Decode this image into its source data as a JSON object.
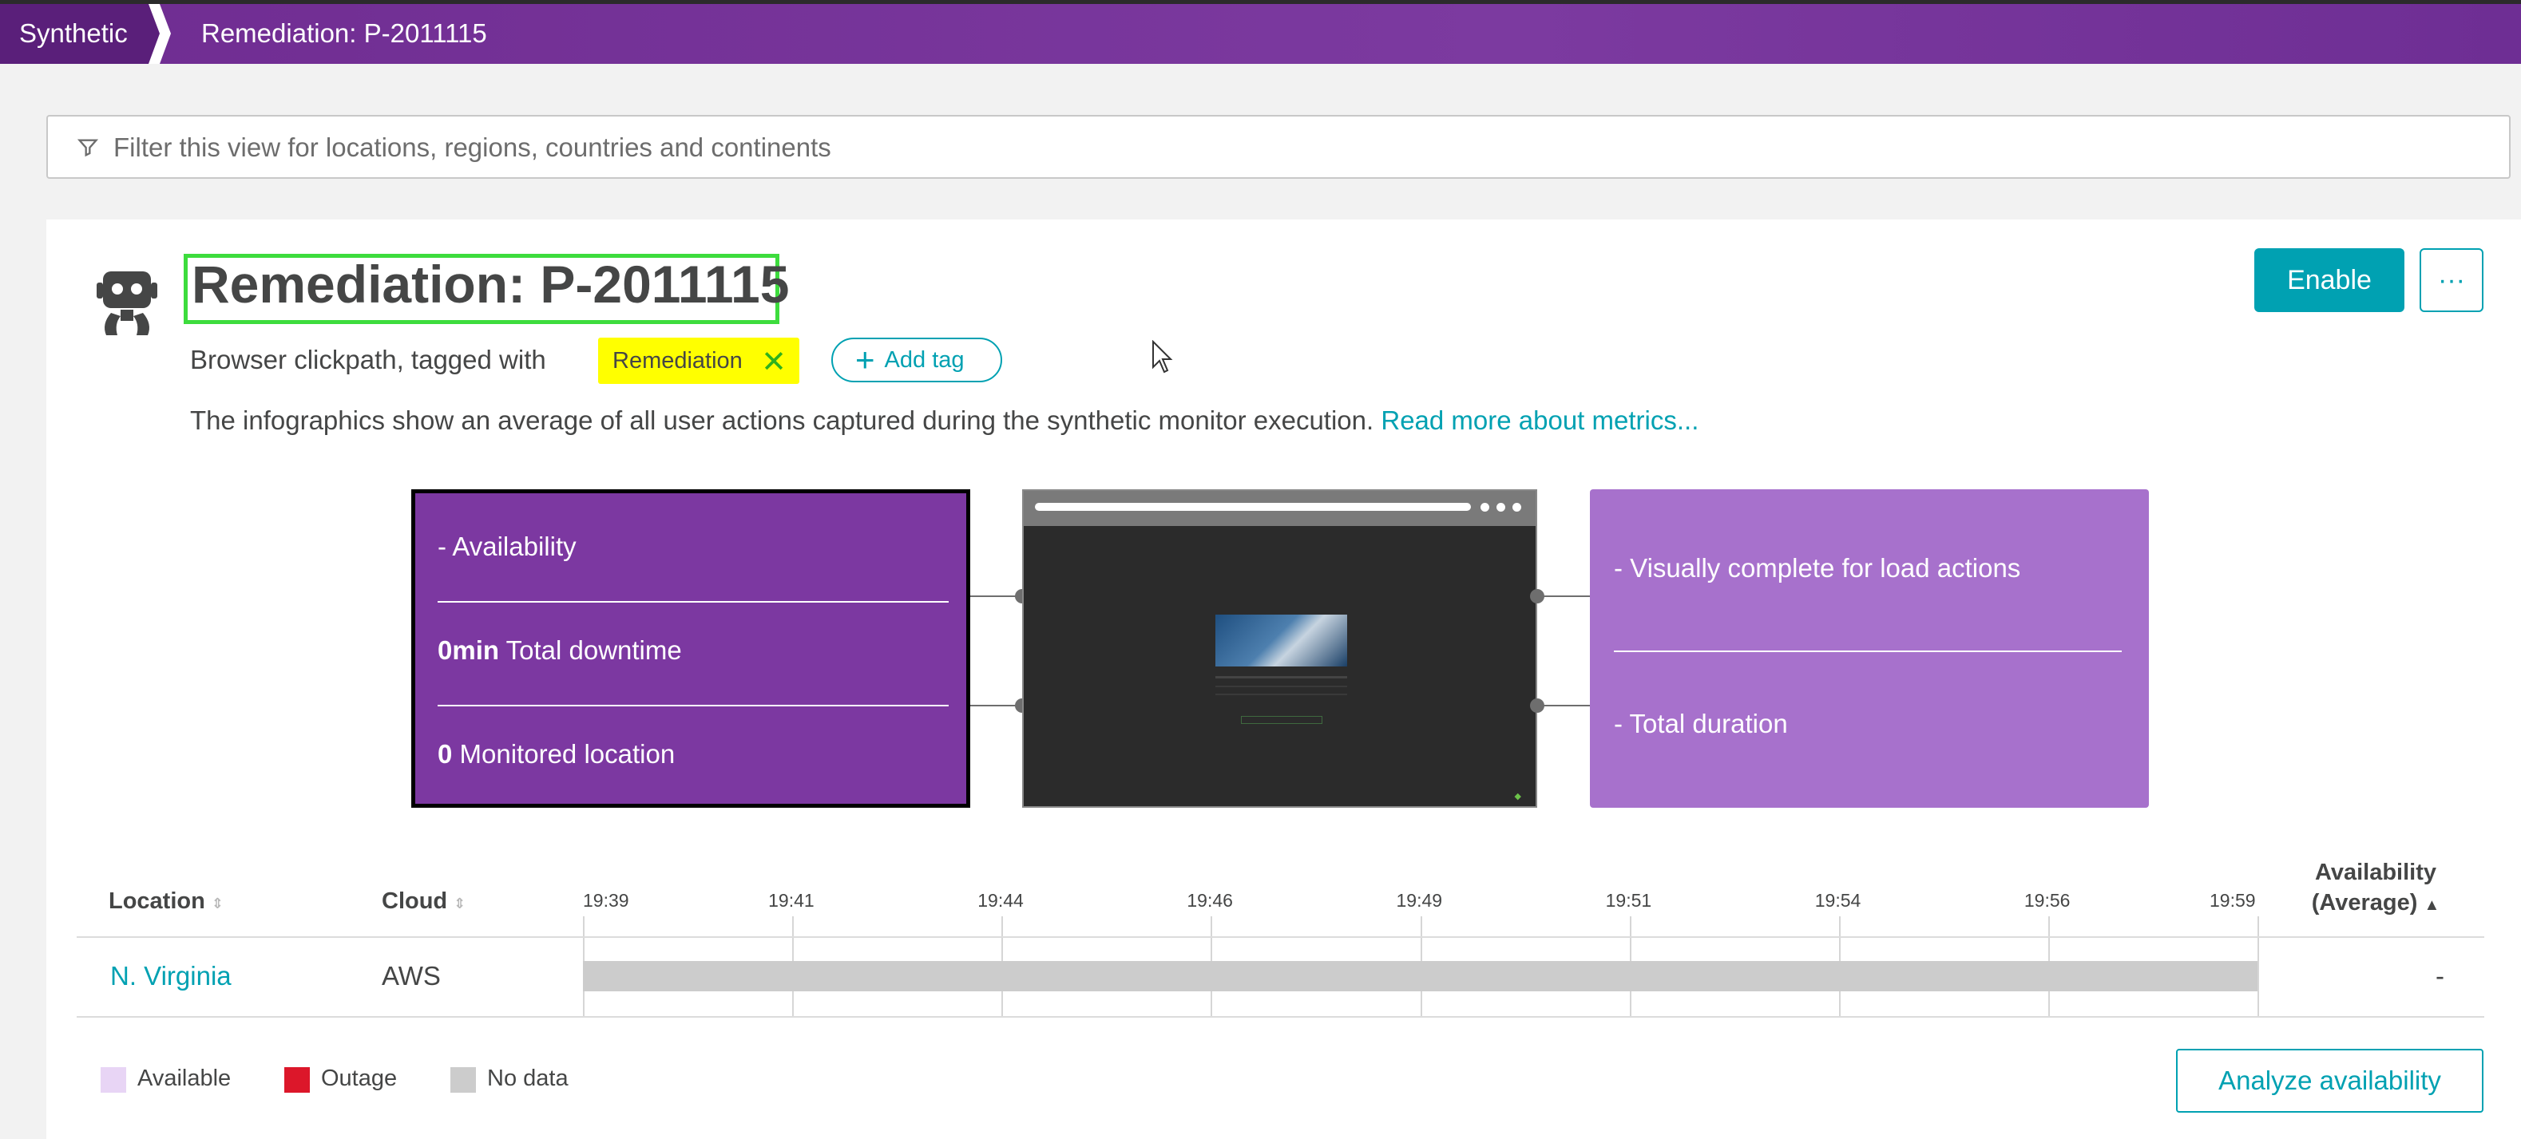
{
  "breadcrumb": {
    "root": "Synthetic",
    "current": "Remediation: P-2011115"
  },
  "filter": {
    "placeholder": "Filter this view for locations, regions, countries and continents"
  },
  "monitor": {
    "title": "Remediation: P-2011115",
    "subtitle": "Browser clickpath, tagged with",
    "tag": "Remediation",
    "add_tag": "Add tag",
    "description": "The infographics show an average of all user actions captured during the synthetic monitor execution.",
    "read_more": "Read more about metrics...",
    "enable": "Enable",
    "more": "···"
  },
  "infographic": {
    "availability": "- Availability",
    "downtime_value": "0min",
    "downtime_label": "Total downtime",
    "locations_value": "0",
    "locations_label": "Monitored location",
    "visually_complete": "- Visually complete for load actions",
    "total_duration": "- Total duration"
  },
  "table": {
    "headers": {
      "location": "Location",
      "cloud": "Cloud",
      "availability_line1": "Availability",
      "availability_line2": "(Average)"
    },
    "timeline_ticks": [
      "19:39",
      "19:41",
      "19:44",
      "19:46",
      "19:49",
      "19:51",
      "19:54",
      "19:56",
      "19:59"
    ],
    "rows": [
      {
        "location": "N. Virginia",
        "cloud": "AWS",
        "availability": "-"
      }
    ]
  },
  "legend": [
    {
      "label": "Available",
      "color": "#e8d5f5"
    },
    {
      "label": "Outage",
      "color": "#dc172a"
    },
    {
      "label": "No data",
      "color": "#cccccc"
    }
  ],
  "analyze_button": "Analyze availability",
  "colors": {
    "accent": "#00a1b2",
    "brand": "#7c38a1",
    "tag_highlight": "#ffff00",
    "title_highlight": "#3ddc3d"
  }
}
